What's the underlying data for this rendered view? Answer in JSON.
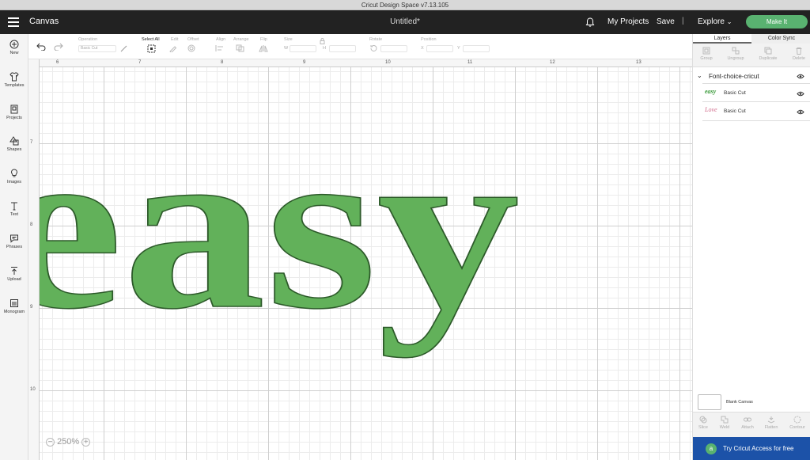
{
  "window": {
    "title": "Cricut Design Space  v7.13.105"
  },
  "header": {
    "section": "Canvas",
    "document_title": "Untitled*",
    "my_projects": "My Projects",
    "save": "Save",
    "separator": "|",
    "explore": "Explore",
    "make_it": "Make It"
  },
  "left_nav": {
    "items": [
      {
        "label": "New",
        "icon": "plus-circle-icon"
      },
      {
        "label": "Templates",
        "icon": "shirt-icon"
      },
      {
        "label": "Projects",
        "icon": "projects-icon"
      },
      {
        "label": "Shapes",
        "icon": "shapes-icon"
      },
      {
        "label": "Images",
        "icon": "lightbulb-icon"
      },
      {
        "label": "Text",
        "icon": "text-icon"
      },
      {
        "label": "Phrases",
        "icon": "speech-bubble-icon"
      },
      {
        "label": "Upload",
        "icon": "upload-icon"
      },
      {
        "label": "Monogram",
        "icon": "monogram-icon"
      }
    ]
  },
  "toolbar": {
    "operation_label": "Operation",
    "operation_value": "Basic Cut",
    "select_all": "Select All",
    "edit": "Edit",
    "offset": "Offset",
    "align": "Align",
    "arrange": "Arrange",
    "flip": "Flip",
    "size": "Size",
    "size_w": "W",
    "size_h": "H",
    "rotate": "Rotate",
    "position": "Position",
    "pos_x": "X",
    "pos_y": "Y"
  },
  "rulers": {
    "top": [
      "6",
      "7",
      "8",
      "9",
      "10",
      "11",
      "12",
      "13"
    ],
    "left": [
      "7",
      "8",
      "9",
      "10"
    ]
  },
  "canvas": {
    "text": "easy",
    "text_color": "#62b15a",
    "zoom": "250%"
  },
  "right_panel": {
    "tabs": [
      "Layers",
      "Color Sync"
    ],
    "tools": [
      "Group",
      "Ungroup",
      "Duplicate",
      "Delete"
    ],
    "group_name": "Font-choice-cricut",
    "layers": [
      {
        "thumb": "easy",
        "name": "Basic Cut",
        "thumb_color": "#3a9a3a"
      },
      {
        "thumb": "Love",
        "name": "Basic Cut",
        "thumb_color": "#d06a8a"
      }
    ],
    "blank_canvas": "Blank Canvas",
    "bottom_tools": [
      "Slice",
      "Weld",
      "Attach",
      "Flatten",
      "Contour"
    ],
    "access_banner": "Try Cricut Access for free"
  },
  "colors": {
    "accent": "#59b270",
    "header": "#222222",
    "access_blue": "#1c52a8"
  }
}
